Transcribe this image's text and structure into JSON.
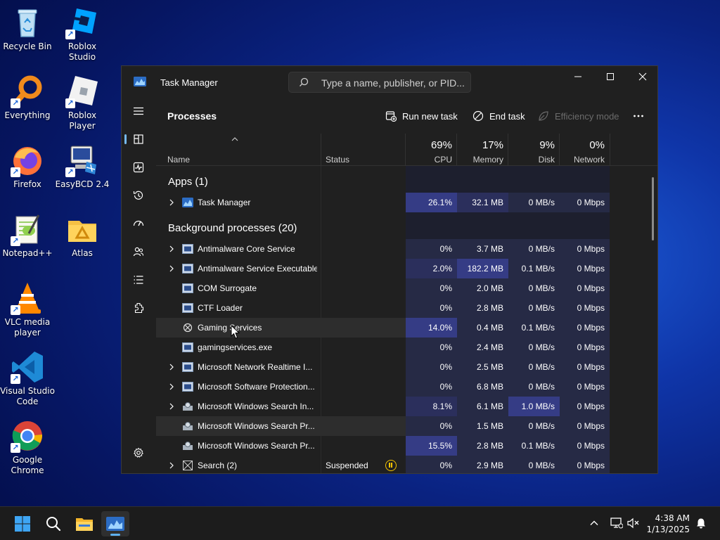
{
  "desktop": {
    "icons": [
      {
        "label": "Recycle Bin",
        "icon": "recycle-bin-icon"
      },
      {
        "label": "Roblox Studio",
        "icon": "roblox-studio-icon"
      },
      {
        "label": "Everything",
        "icon": "everything-search-icon"
      },
      {
        "label": "Roblox Player",
        "icon": "roblox-player-icon"
      },
      {
        "label": "Firefox",
        "icon": "firefox-icon"
      },
      {
        "label": "EasyBCD 2.4",
        "icon": "easybcd-icon"
      },
      {
        "label": "Notepad++",
        "icon": "notepad-plus-plus-icon"
      },
      {
        "label": "Atlas",
        "icon": "atlas-folder-icon"
      },
      {
        "label": "VLC media player",
        "icon": "vlc-icon"
      },
      {
        "label": "Visual Studio Code",
        "icon": "vscode-icon"
      },
      {
        "label": "Google Chrome",
        "icon": "chrome-icon"
      }
    ]
  },
  "taskmanager": {
    "title": "Task Manager",
    "search_placeholder": "Type a name, publisher, or PID...",
    "heading": "Processes",
    "toolbar": {
      "run_new_task": "Run new task",
      "end_task": "End task",
      "efficiency_mode": "Efficiency mode"
    },
    "nav": [
      "processes-icon",
      "performance-icon",
      "app-history-icon",
      "startup-apps-icon",
      "users-icon",
      "details-icon",
      "services-icon",
      "settings-icon"
    ],
    "columns": {
      "name": "Name",
      "status": "Status",
      "cpu_pct": "69%",
      "cpu": "CPU",
      "mem_pct": "17%",
      "mem": "Memory",
      "disk_pct": "9%",
      "disk": "Disk",
      "net_pct": "0%",
      "net": "Network"
    },
    "groups": {
      "apps": "Apps (1)",
      "background": "Background processes (20)"
    },
    "rows": [
      {
        "name": "Task Manager",
        "status": "",
        "cpu": "26.1%",
        "mem": "32.1 MB",
        "disk": "0 MB/s",
        "net": "0 Mbps"
      },
      {
        "name": "Antimalware Core Service",
        "status": "",
        "cpu": "0%",
        "mem": "3.7 MB",
        "disk": "0 MB/s",
        "net": "0 Mbps"
      },
      {
        "name": "Antimalware Service Executable",
        "status": "",
        "cpu": "2.0%",
        "mem": "182.2 MB",
        "disk": "0.1 MB/s",
        "net": "0 Mbps"
      },
      {
        "name": "COM Surrogate",
        "status": "",
        "cpu": "0%",
        "mem": "2.0 MB",
        "disk": "0 MB/s",
        "net": "0 Mbps"
      },
      {
        "name": "CTF Loader",
        "status": "",
        "cpu": "0%",
        "mem": "2.8 MB",
        "disk": "0 MB/s",
        "net": "0 Mbps"
      },
      {
        "name": "Gaming Services",
        "status": "",
        "cpu": "14.0%",
        "mem": "0.4 MB",
        "disk": "0.1 MB/s",
        "net": "0 Mbps"
      },
      {
        "name": "gamingservices.exe",
        "status": "",
        "cpu": "0%",
        "mem": "2.4 MB",
        "disk": "0 MB/s",
        "net": "0 Mbps"
      },
      {
        "name": "Microsoft Network Realtime I...",
        "status": "",
        "cpu": "0%",
        "mem": "2.5 MB",
        "disk": "0 MB/s",
        "net": "0 Mbps"
      },
      {
        "name": "Microsoft Software Protection...",
        "status": "",
        "cpu": "0%",
        "mem": "6.8 MB",
        "disk": "0 MB/s",
        "net": "0 Mbps"
      },
      {
        "name": "Microsoft Windows Search In...",
        "status": "",
        "cpu": "8.1%",
        "mem": "6.1 MB",
        "disk": "1.0 MB/s",
        "net": "0 Mbps"
      },
      {
        "name": "Microsoft Windows Search Pr...",
        "status": "",
        "cpu": "0%",
        "mem": "1.5 MB",
        "disk": "0 MB/s",
        "net": "0 Mbps"
      },
      {
        "name": "Microsoft Windows Search Pr...",
        "status": "",
        "cpu": "15.5%",
        "mem": "2.8 MB",
        "disk": "0.1 MB/s",
        "net": "0 Mbps"
      },
      {
        "name": "Search (2)",
        "status": "Suspended",
        "cpu": "0%",
        "mem": "2.9 MB",
        "disk": "0 MB/s",
        "net": "0 Mbps"
      }
    ]
  },
  "taskbar": {
    "time": "4:38 AM",
    "date": "1/13/2025",
    "pinned": [
      "windows-start-icon",
      "search-icon",
      "file-explorer-icon",
      "task-manager-icon"
    ]
  },
  "colors": {
    "heat_low": "#262a45",
    "heat_mid": "#2b2f5c",
    "heat_high": "#353c85",
    "accent": "#76b9ed"
  }
}
